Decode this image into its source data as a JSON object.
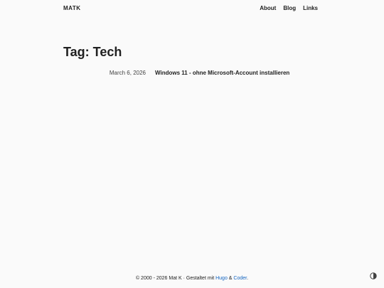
{
  "nav": {
    "brand": "MATK",
    "items": [
      {
        "label": "About"
      },
      {
        "label": "Blog"
      },
      {
        "label": "Links"
      }
    ]
  },
  "page": {
    "title": "Tag: Tech"
  },
  "posts": [
    {
      "date": "March 6, 2026",
      "title": "Windows 11 - ohne Microsoft-Account installieren"
    }
  ],
  "footer": {
    "copyright": "© 2000 - 2026 Mat K · Gestaltet mit ",
    "link1": "Hugo",
    "sep": " & ",
    "link2": "Coder",
    "end": "."
  },
  "colors": {
    "background": "#fafafa",
    "text": "#212121",
    "link": "#1565c0"
  },
  "icons": {
    "theme_toggle": "contrast-icon"
  }
}
